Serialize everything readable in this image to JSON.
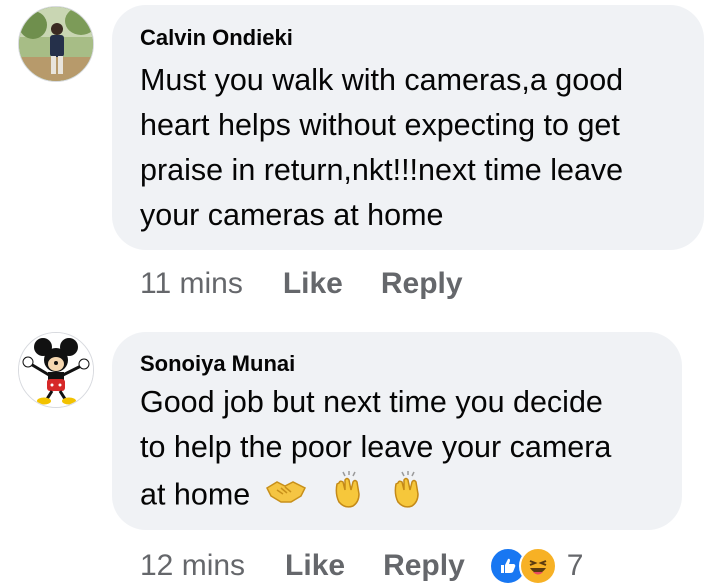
{
  "comments": [
    {
      "author": "Calvin Ondieki",
      "text_lines": [
        "Must you walk with cameras,a good",
        "heart helps without expecting to get",
        "praise in return,nkt!!!next time leave",
        "your cameras at home"
      ],
      "time": "11 mins",
      "like_label": "Like",
      "reply_label": "Reply",
      "avatar_icon": "person-outdoors-photo"
    },
    {
      "author": "Sonoiya Munai",
      "text_lines": [
        "Good job but next time you decide",
        "to help the poor leave your camera",
        "at home"
      ],
      "emojis": [
        "handshake-icon",
        "clapping-hands-icon",
        "clapping-hands-icon"
      ],
      "time": "12 mins",
      "like_label": "Like",
      "reply_label": "Reply",
      "avatar_icon": "mickey-mouse-icon",
      "reactions": {
        "icons": [
          "like-reaction-icon",
          "haha-reaction-icon"
        ],
        "count": "7"
      }
    }
  ],
  "colors": {
    "bubble_bg": "#f0f2f5",
    "meta_text": "#65676b",
    "like_blue": "#1877f2",
    "haha_yellow": "#f7b125"
  }
}
